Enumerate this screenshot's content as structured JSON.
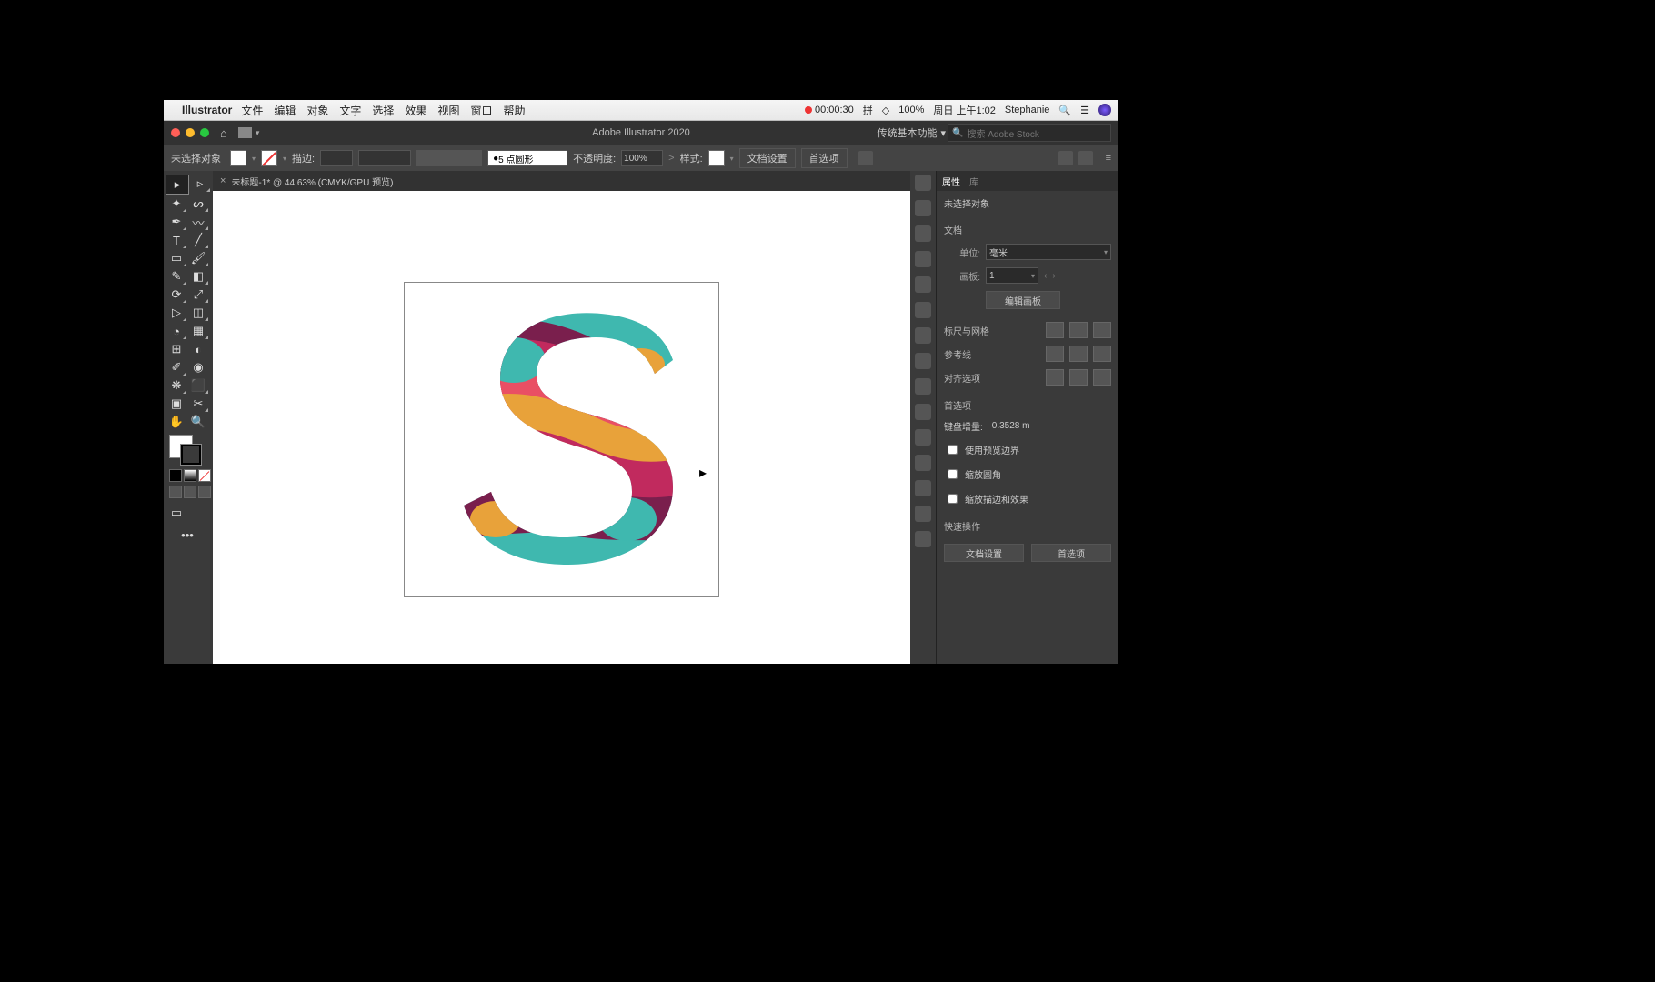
{
  "menubar": {
    "app_name": "Illustrator",
    "menus": [
      "文件",
      "编辑",
      "对象",
      "文字",
      "选择",
      "效果",
      "视图",
      "窗口",
      "帮助"
    ],
    "recording": "00:00:30",
    "battery": "100%",
    "datetime": "周日 上午1:02",
    "user": "Stephanie"
  },
  "appbar": {
    "title": "Adobe Illustrator 2020",
    "workspace": "传统基本功能",
    "search_placeholder": "搜索 Adobe Stock"
  },
  "ctrlbar": {
    "status": "未选择对象",
    "stroke_label": "描边:",
    "stroke_profile": "5 点圆形",
    "opacity_label": "不透明度:",
    "opacity": "100%",
    "style_label": "样式:",
    "doc_setup": "文档设置",
    "preferences": "首选项"
  },
  "tab": {
    "name": "未标题-1* @ 44.63% (CMYK/GPU 预览)"
  },
  "props": {
    "tab1": "属性",
    "tab2": "库",
    "no_selection": "未选择对象",
    "doc_section": "文档",
    "unit_label": "单位:",
    "unit_value": "毫米",
    "artboard_label": "画板:",
    "artboard_value": "1",
    "edit_artboards": "编辑画板",
    "ruler_section": "标尺与网格",
    "guides_section": "参考线",
    "snap_section": "对齐选项",
    "prefs_section": "首选项",
    "key_inc_label": "键盘增量:",
    "key_inc_value": "0.3528 m",
    "chk1": "使用预览边界",
    "chk2": "缩放圆角",
    "chk3": "缩放描边和效果",
    "quick_section": "快速操作",
    "qa_doc": "文档设置",
    "qa_pref": "首选项"
  }
}
